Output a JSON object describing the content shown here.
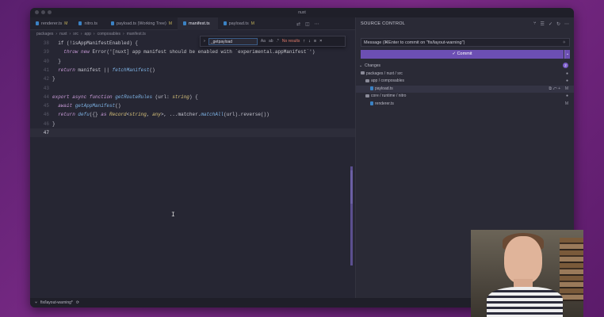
{
  "window": {
    "title": "nuxt"
  },
  "tabs": [
    {
      "label": "renderer.ts",
      "mod": "M",
      "active": false
    },
    {
      "label": "nitro.ts",
      "mod": "",
      "active": false
    },
    {
      "label": "payload.ts (Working Tree)",
      "mod": "M",
      "active": false
    },
    {
      "label": "manifest.ts",
      "mod": "",
      "active": true
    },
    {
      "label": "payload.ts",
      "mod": "M",
      "active": false
    }
  ],
  "breadcrumb": [
    "packages",
    "nuxt",
    "src",
    "app",
    "composables",
    "manifest.ts"
  ],
  "find": {
    "query": "_getpayload",
    "opt_case": "Aa",
    "opt_word": "ab",
    "opt_regex": ".*",
    "result": "No results"
  },
  "code_lines": [
    {
      "n": "38",
      "code": "  if (!isAppManifestEnabled) {"
    },
    {
      "n": "39",
      "code": "    throw new Error('[nuxt] app manifest should be enabled with `experimental.appManifest`')"
    },
    {
      "n": "40",
      "code": "  }"
    },
    {
      "n": "41",
      "code": "  return manifest || fetchManifest()"
    },
    {
      "n": "42",
      "code": "}"
    },
    {
      "n": "43",
      "code": ""
    },
    {
      "n": "44",
      "code": "export async function getRouteRules (url: string) {"
    },
    {
      "n": "45",
      "code": "  await getAppManifest()"
    },
    {
      "n": "46",
      "code": "  return defu({} as Record<string, any>, ...matcher.matchAll(url).reverse())"
    },
    {
      "n": "46",
      "code": "}"
    },
    {
      "n": "47",
      "code": ""
    }
  ],
  "statusbar": {
    "branch": "fix/layout-warning*"
  },
  "source_control": {
    "header": "SOURCE CONTROL",
    "message_placeholder": "Message (⌘Enter to commit on \"fix/layout-warning\")",
    "commit_label": "✓ Commit",
    "changes_label": "Changes",
    "changes_count": "2",
    "tree": [
      {
        "label": "packages / nuxt / src",
        "indent": 0,
        "kind": "folder",
        "status": "●"
      },
      {
        "label": "app / composables",
        "indent": 1,
        "kind": "folder",
        "status": "●"
      },
      {
        "label": "payload.ts",
        "indent": 2,
        "kind": "file",
        "status": "M",
        "selected": true
      },
      {
        "label": "core / runtime / nitro",
        "indent": 1,
        "kind": "folder",
        "status": "●"
      },
      {
        "label": "renderer.ts",
        "indent": 2,
        "kind": "file",
        "status": "M"
      }
    ]
  }
}
